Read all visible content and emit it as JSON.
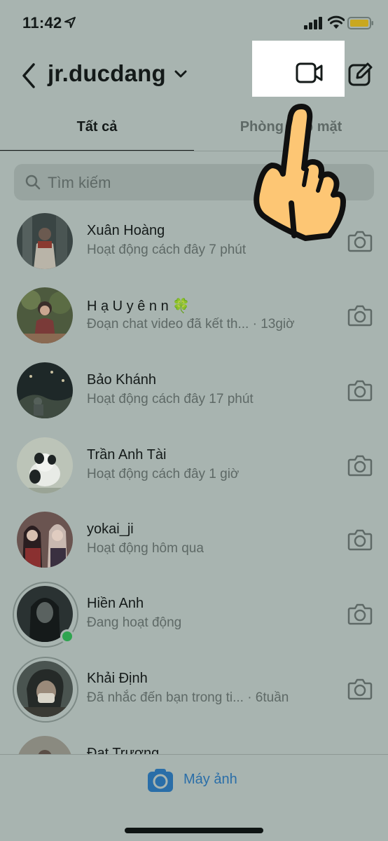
{
  "status_bar": {
    "time": "11:42"
  },
  "header": {
    "account_name": "jr.ducdang"
  },
  "tabs": [
    {
      "label": "Tất cả"
    },
    {
      "label": "Phòng họp mặt"
    }
  ],
  "search": {
    "placeholder": "Tìm kiếm"
  },
  "conversations": [
    {
      "name": "Xuân Hoàng",
      "subtitle": "Hoạt động cách đây 7 phút"
    },
    {
      "name": "H ạ  U y ê n n 🍀",
      "subtitle": "Đoạn chat video đã kết th... · 13giờ"
    },
    {
      "name": "Bảo Khánh",
      "subtitle": "Hoạt động cách đây 17 phút"
    },
    {
      "name": "Trần Anh Tài",
      "subtitle": "Hoạt động cách đây 1 giờ"
    },
    {
      "name": "yokai_ji",
      "subtitle": "Hoạt động hôm qua"
    },
    {
      "name": "Hiền Anh",
      "subtitle": "Đang hoạt động"
    },
    {
      "name": "Khải Định",
      "subtitle": "Đã nhắc đến bạn trong ti... · 6tuần"
    },
    {
      "name": "Đạt Trương",
      "subtitle": ""
    }
  ],
  "bottom_bar": {
    "camera_label": "Máy ảnh"
  },
  "colors": {
    "overlay_background": "#a8b4b0",
    "text_primary": "#141a19",
    "text_secondary": "#5e6966",
    "link_blue": "#2a6ea8",
    "online_green": "#2ea44f",
    "highlight": "#ffffff",
    "hand_fill": "#fdc674"
  }
}
